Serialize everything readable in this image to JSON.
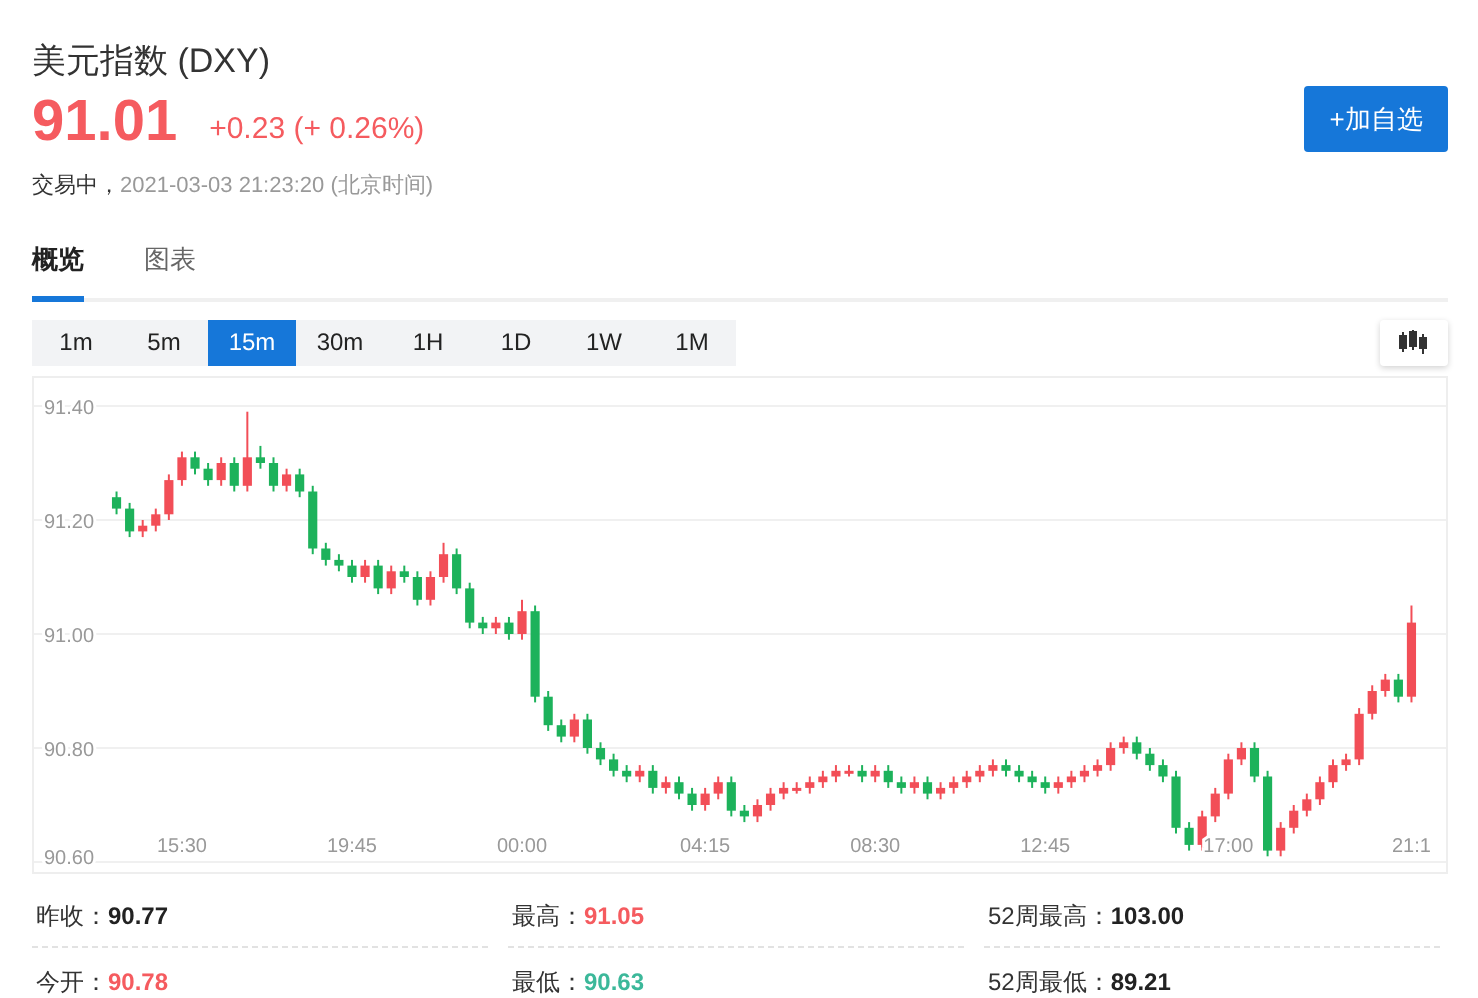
{
  "header": {
    "title": "美元指数 (DXY)",
    "price": "91.01",
    "change": "+0.23 (+ 0.26%)",
    "color": "#f55b5f",
    "status": "交易中，",
    "time": "2021-03-03 21:23:20 (北京时间)",
    "button": "+加自选"
  },
  "tabs": [
    {
      "label": "概览",
      "selected": true
    },
    {
      "label": "图表",
      "selected": false
    }
  ],
  "intervals": [
    {
      "label": "1m",
      "selected": false
    },
    {
      "label": "5m",
      "selected": false
    },
    {
      "label": "15m",
      "selected": true
    },
    {
      "label": "30m",
      "selected": false
    },
    {
      "label": "1H",
      "selected": false
    },
    {
      "label": "1D",
      "selected": false
    },
    {
      "label": "1W",
      "selected": false
    },
    {
      "label": "1M",
      "selected": false
    }
  ],
  "chart_data": {
    "type": "candlestick",
    "grid": true,
    "ylim": [
      90.6,
      91.4
    ],
    "yticks": [
      {
        "value": 91.4,
        "label": "91.40"
      },
      {
        "value": 91.2,
        "label": "91.20"
      },
      {
        "value": 91.0,
        "label": "91.00"
      },
      {
        "value": 90.8,
        "label": "90.80"
      },
      {
        "value": 90.6,
        "label": "90.60"
      }
    ],
    "categories": [
      null,
      null,
      null,
      null,
      null,
      "15:30",
      null,
      null,
      null,
      null,
      null,
      null,
      null,
      null,
      null,
      null,
      null,
      null,
      "19:45",
      null,
      null,
      null,
      null,
      null,
      null,
      null,
      null,
      null,
      null,
      null,
      null,
      "00:00",
      null,
      null,
      null,
      null,
      null,
      null,
      null,
      null,
      null,
      null,
      null,
      null,
      null,
      "04:15",
      null,
      null,
      null,
      null,
      null,
      null,
      null,
      null,
      null,
      null,
      null,
      null,
      "08:30",
      null,
      null,
      null,
      null,
      null,
      null,
      null,
      null,
      null,
      null,
      null,
      null,
      "12:45",
      null,
      null,
      null,
      null,
      null,
      null,
      null,
      null,
      null,
      null,
      null,
      null,
      null,
      "17:00",
      null,
      null,
      null,
      null,
      null,
      null,
      null,
      null,
      null,
      null,
      null,
      null,
      null,
      "21:1"
    ],
    "ohlc": [
      [
        91.24,
        91.25,
        91.21,
        91.22
      ],
      [
        91.22,
        91.23,
        91.17,
        91.18
      ],
      [
        91.18,
        91.2,
        91.17,
        91.19
      ],
      [
        91.19,
        91.22,
        91.18,
        91.21
      ],
      [
        91.21,
        91.28,
        91.2,
        91.27
      ],
      [
        91.27,
        91.32,
        91.26,
        91.31
      ],
      [
        91.31,
        91.32,
        91.28,
        91.29
      ],
      [
        91.29,
        91.3,
        91.26,
        91.27
      ],
      [
        91.27,
        91.31,
        91.26,
        91.3
      ],
      [
        91.3,
        91.31,
        91.25,
        91.26
      ],
      [
        91.26,
        91.39,
        91.25,
        91.31
      ],
      [
        91.31,
        91.33,
        91.29,
        91.3
      ],
      [
        91.3,
        91.31,
        91.25,
        91.26
      ],
      [
        91.26,
        91.29,
        91.25,
        91.28
      ],
      [
        91.28,
        91.29,
        91.24,
        91.25
      ],
      [
        91.25,
        91.26,
        91.14,
        91.15
      ],
      [
        91.15,
        91.16,
        91.12,
        91.13
      ],
      [
        91.13,
        91.14,
        91.11,
        91.12
      ],
      [
        91.12,
        91.13,
        91.09,
        91.1
      ],
      [
        91.1,
        91.13,
        91.09,
        91.12
      ],
      [
        91.12,
        91.13,
        91.07,
        91.08
      ],
      [
        91.08,
        91.12,
        91.07,
        91.11
      ],
      [
        91.11,
        91.12,
        91.09,
        91.1
      ],
      [
        91.1,
        91.11,
        91.05,
        91.06
      ],
      [
        91.06,
        91.11,
        91.05,
        91.1
      ],
      [
        91.1,
        91.16,
        91.09,
        91.14
      ],
      [
        91.14,
        91.15,
        91.07,
        91.08
      ],
      [
        91.08,
        91.09,
        91.01,
        91.02
      ],
      [
        91.02,
        91.03,
        91.0,
        91.01
      ],
      [
        91.01,
        91.03,
        91.0,
        91.02
      ],
      [
        91.02,
        91.03,
        90.99,
        91.0
      ],
      [
        91.0,
        91.06,
        90.99,
        91.04
      ],
      [
        91.04,
        91.05,
        90.88,
        90.89
      ],
      [
        90.89,
        90.9,
        90.83,
        90.84
      ],
      [
        90.84,
        90.85,
        90.81,
        90.82
      ],
      [
        90.82,
        90.86,
        90.81,
        90.85
      ],
      [
        90.85,
        90.86,
        90.79,
        90.8
      ],
      [
        90.8,
        90.81,
        90.77,
        90.78
      ],
      [
        90.78,
        90.79,
        90.75,
        90.76
      ],
      [
        90.76,
        90.77,
        90.74,
        90.75
      ],
      [
        90.75,
        90.77,
        90.74,
        90.76
      ],
      [
        90.76,
        90.77,
        90.72,
        90.73
      ],
      [
        90.73,
        90.75,
        90.72,
        90.74
      ],
      [
        90.74,
        90.75,
        90.71,
        90.72
      ],
      [
        90.72,
        90.73,
        90.69,
        90.7
      ],
      [
        90.7,
        90.73,
        90.69,
        90.72
      ],
      [
        90.72,
        90.75,
        90.71,
        90.74
      ],
      [
        90.74,
        90.75,
        90.68,
        90.69
      ],
      [
        90.69,
        90.7,
        90.67,
        90.68
      ],
      [
        90.68,
        90.71,
        90.67,
        90.7
      ],
      [
        90.7,
        90.73,
        90.69,
        90.72
      ],
      [
        90.72,
        90.74,
        90.71,
        90.73
      ],
      [
        90.73,
        90.74,
        90.72,
        90.73
      ],
      [
        90.73,
        90.75,
        90.72,
        90.74
      ],
      [
        90.74,
        90.76,
        90.73,
        90.75
      ],
      [
        90.75,
        90.77,
        90.74,
        90.76
      ],
      [
        90.76,
        90.77,
        90.75,
        90.76
      ],
      [
        90.76,
        90.77,
        90.74,
        90.75
      ],
      [
        90.75,
        90.77,
        90.74,
        90.76
      ],
      [
        90.76,
        90.77,
        90.73,
        90.74
      ],
      [
        90.74,
        90.75,
        90.72,
        90.73
      ],
      [
        90.73,
        90.75,
        90.72,
        90.74
      ],
      [
        90.74,
        90.75,
        90.71,
        90.72
      ],
      [
        90.72,
        90.74,
        90.71,
        90.73
      ],
      [
        90.73,
        90.75,
        90.72,
        90.74
      ],
      [
        90.74,
        90.76,
        90.73,
        90.75
      ],
      [
        90.75,
        90.77,
        90.74,
        90.76
      ],
      [
        90.76,
        90.78,
        90.75,
        90.77
      ],
      [
        90.77,
        90.78,
        90.75,
        90.76
      ],
      [
        90.76,
        90.77,
        90.74,
        90.75
      ],
      [
        90.75,
        90.76,
        90.73,
        90.74
      ],
      [
        90.74,
        90.75,
        90.72,
        90.73
      ],
      [
        90.73,
        90.75,
        90.72,
        90.74
      ],
      [
        90.74,
        90.76,
        90.73,
        90.75
      ],
      [
        90.75,
        90.77,
        90.74,
        90.76
      ],
      [
        90.76,
        90.78,
        90.75,
        90.77
      ],
      [
        90.77,
        90.81,
        90.76,
        90.8
      ],
      [
        90.8,
        90.82,
        90.79,
        90.81
      ],
      [
        90.81,
        90.82,
        90.78,
        90.79
      ],
      [
        90.79,
        90.8,
        90.76,
        90.77
      ],
      [
        90.77,
        90.78,
        90.74,
        90.75
      ],
      [
        90.75,
        90.76,
        90.65,
        90.66
      ],
      [
        90.66,
        90.67,
        90.62,
        90.63
      ],
      [
        90.63,
        90.69,
        90.62,
        90.68
      ],
      [
        90.68,
        90.73,
        90.67,
        90.72
      ],
      [
        90.72,
        90.79,
        90.71,
        90.78
      ],
      [
        90.78,
        90.81,
        90.77,
        90.8
      ],
      [
        90.8,
        90.81,
        90.74,
        90.75
      ],
      [
        90.75,
        90.76,
        90.61,
        90.62
      ],
      [
        90.62,
        90.67,
        90.61,
        90.66
      ],
      [
        90.66,
        90.7,
        90.65,
        90.69
      ],
      [
        90.69,
        90.72,
        90.68,
        90.71
      ],
      [
        90.71,
        90.75,
        90.7,
        90.74
      ],
      [
        90.74,
        90.78,
        90.73,
        90.77
      ],
      [
        90.77,
        90.79,
        90.76,
        90.78
      ],
      [
        90.78,
        90.87,
        90.77,
        90.86
      ],
      [
        90.86,
        90.91,
        90.85,
        90.9
      ],
      [
        90.9,
        90.93,
        90.89,
        90.92
      ],
      [
        90.92,
        90.93,
        90.88,
        90.89
      ],
      [
        90.89,
        91.05,
        90.88,
        91.02
      ]
    ]
  },
  "stats": [
    {
      "label": "昨收：",
      "value": "90.77",
      "color": "#222222"
    },
    {
      "label": "最高：",
      "value": "91.05",
      "color": "#f55b5f"
    },
    {
      "label": "52周最高：",
      "value": "103.00",
      "color": "#222222"
    },
    {
      "label": "今开：",
      "value": "90.78",
      "color": "#f55b5f"
    },
    {
      "label": "最低：",
      "value": "90.63",
      "color": "#3cb89a"
    },
    {
      "label": "52周最低：",
      "value": "89.21",
      "color": "#222222"
    }
  ]
}
